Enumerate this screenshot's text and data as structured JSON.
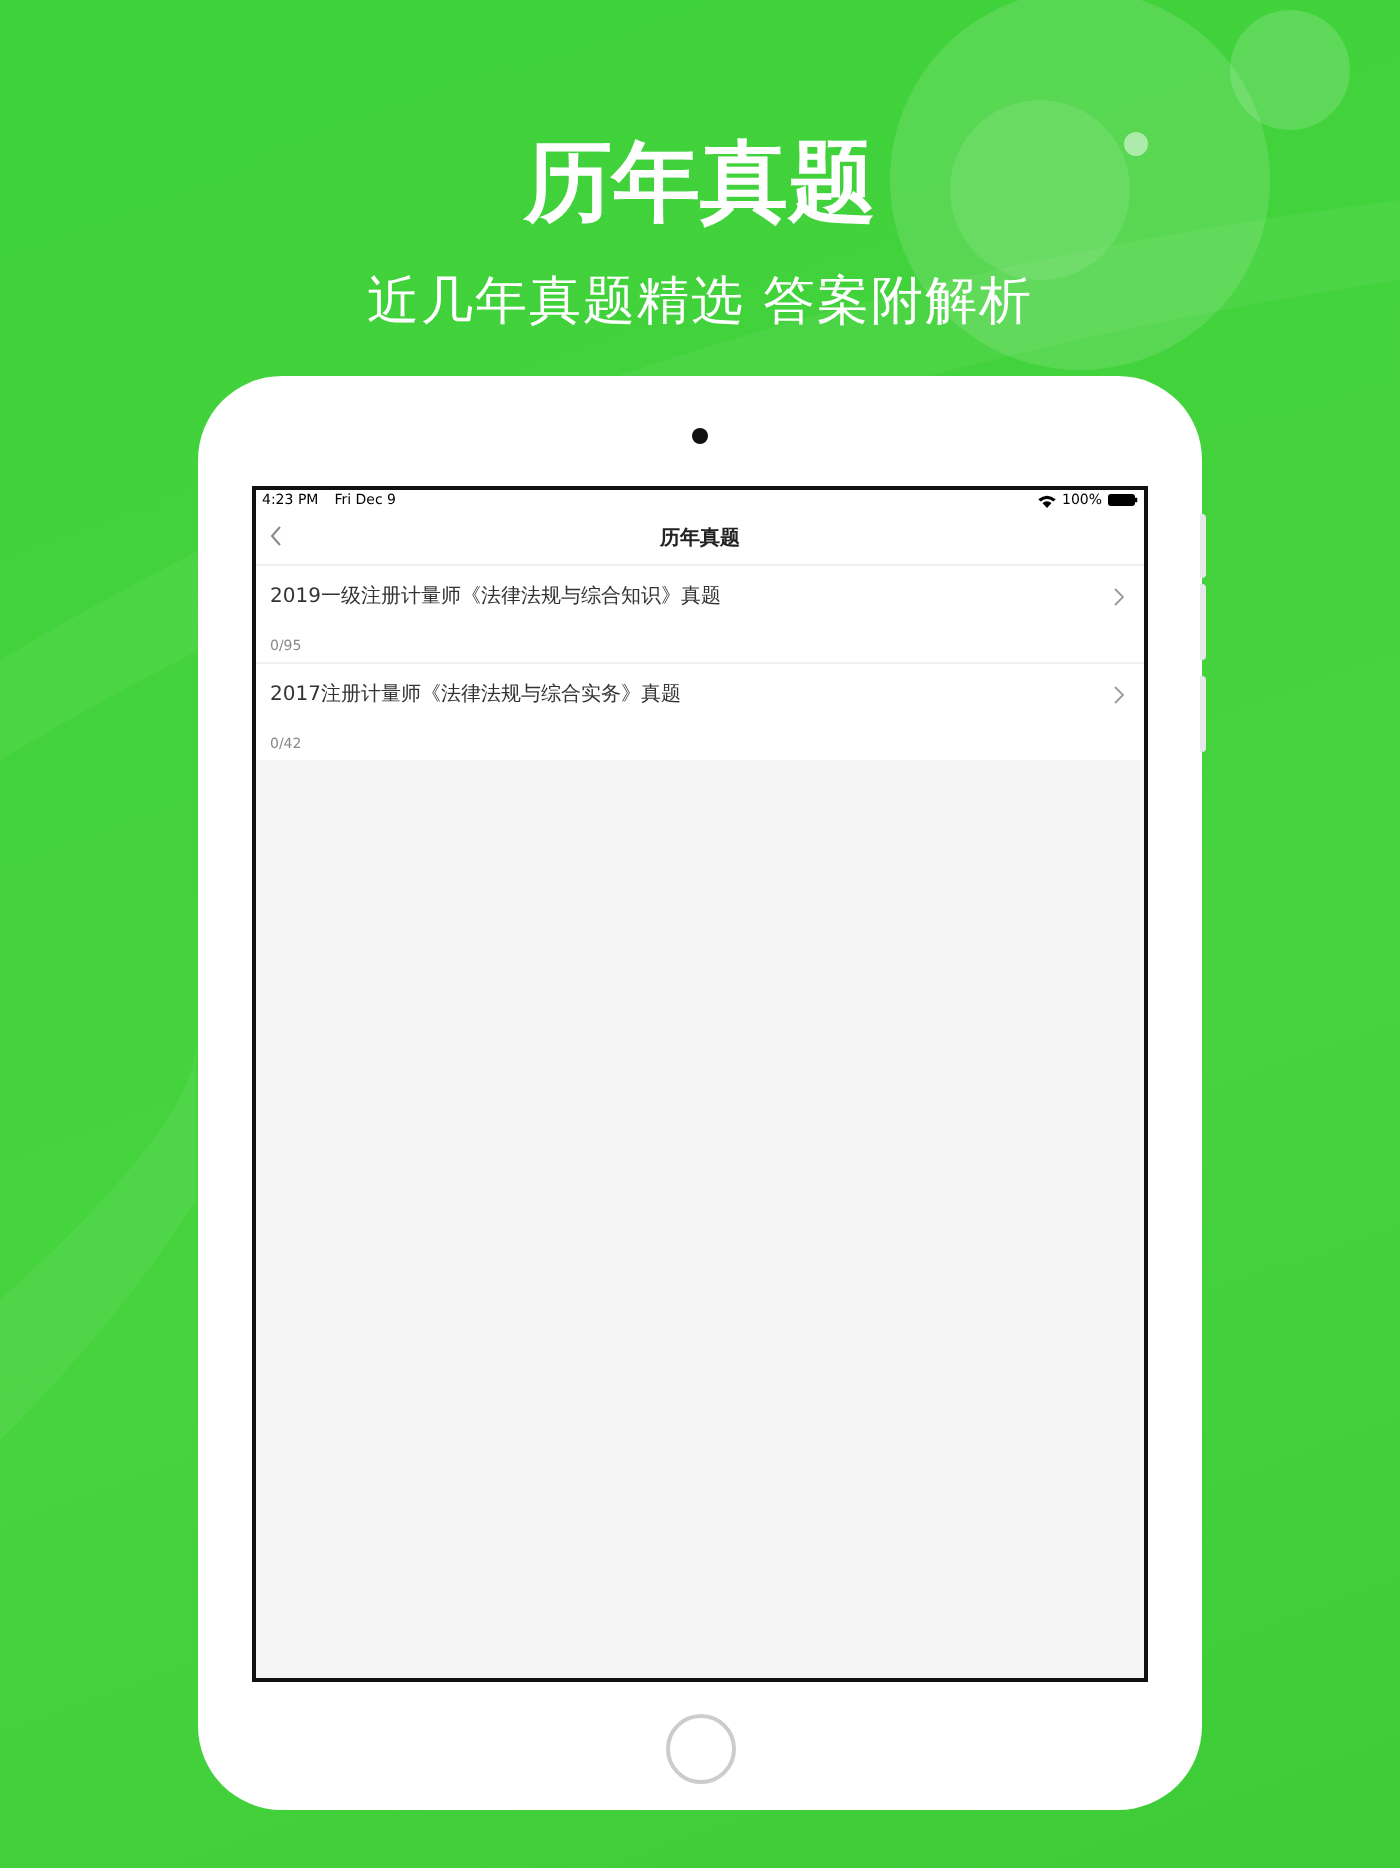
{
  "headline": "历年真题",
  "subtitle": "近几年真题精选 答案附解析",
  "status_bar": {
    "time": "4:23 PM",
    "date": "Fri Dec 9",
    "battery": "100%"
  },
  "nav": {
    "title": "历年真题"
  },
  "items": [
    {
      "title": "2019一级注册计量师《法律法规与综合知识》真题",
      "progress": "0/95"
    },
    {
      "title": "2017注册计量师《法律法规与综合实务》真题",
      "progress": "0/42"
    }
  ]
}
